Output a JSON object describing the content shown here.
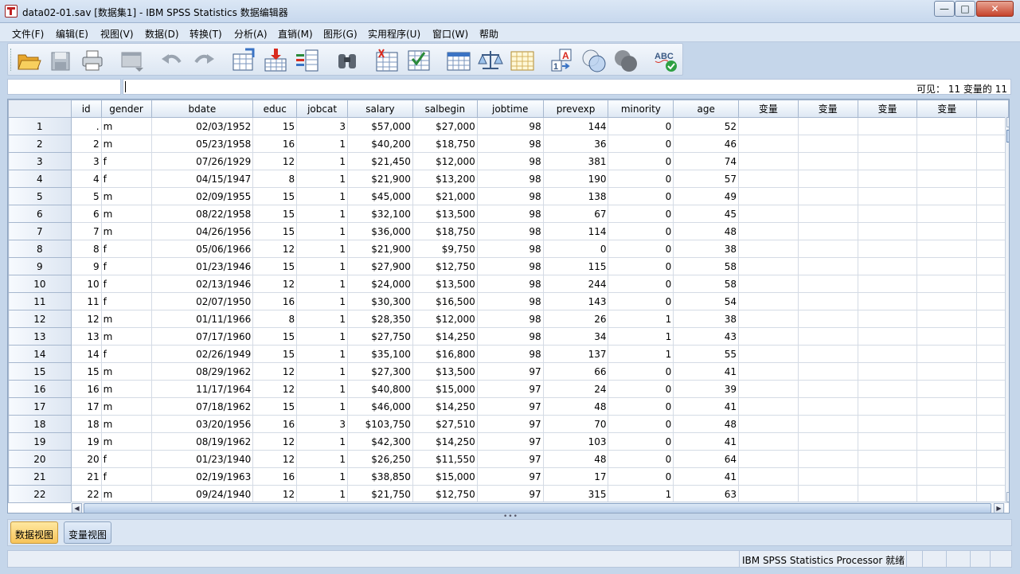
{
  "window": {
    "title": "data02-01.sav [数据集1] - IBM SPSS Statistics 数据编辑器",
    "minimize_label": "—",
    "maximize_label": "□",
    "close_label": "✕"
  },
  "menu": [
    "文件(F)",
    "编辑(E)",
    "视图(V)",
    "数据(D)",
    "转换(T)",
    "分析(A)",
    "直销(M)",
    "图形(G)",
    "实用程序(U)",
    "窗口(W)",
    "帮助"
  ],
  "toolbar_icons": [
    "open-folder-icon",
    "save-icon",
    "print-icon",
    "dialog-recall-icon",
    "undo-icon",
    "redo-icon",
    "goto-case-icon",
    "goto-variable-icon",
    "variables-icon",
    "find-icon",
    "insert-cases-icon",
    "insert-variable-icon",
    "split-file-icon",
    "weight-cases-icon",
    "select-cases-icon",
    "value-labels-icon",
    "use-variable-sets-icon",
    "show-all-variables-icon",
    "spell-check-icon"
  ],
  "cell_editor": {
    "reference": "",
    "value": "",
    "visible_count": "可见： 11 变量的 11"
  },
  "grid": {
    "columns": [
      "id",
      "gender",
      "bdate",
      "educ",
      "jobcat",
      "salary",
      "salbegin",
      "jobtime",
      "prevexp",
      "minority",
      "age",
      "变量",
      "变量",
      "变量",
      "变量"
    ],
    "rows": [
      [
        "1",
        ".",
        "m",
        "02/03/1952",
        "15",
        "3",
        "$57,000",
        "$27,000",
        "98",
        "144",
        "0",
        "52"
      ],
      [
        "2",
        "2",
        "m",
        "05/23/1958",
        "16",
        "1",
        "$40,200",
        "$18,750",
        "98",
        "36",
        "0",
        "46"
      ],
      [
        "3",
        "3",
        "f",
        "07/26/1929",
        "12",
        "1",
        "$21,450",
        "$12,000",
        "98",
        "381",
        "0",
        "74"
      ],
      [
        "4",
        "4",
        "f",
        "04/15/1947",
        "8",
        "1",
        "$21,900",
        "$13,200",
        "98",
        "190",
        "0",
        "57"
      ],
      [
        "5",
        "5",
        "m",
        "02/09/1955",
        "15",
        "1",
        "$45,000",
        "$21,000",
        "98",
        "138",
        "0",
        "49"
      ],
      [
        "6",
        "6",
        "m",
        "08/22/1958",
        "15",
        "1",
        "$32,100",
        "$13,500",
        "98",
        "67",
        "0",
        "45"
      ],
      [
        "7",
        "7",
        "m",
        "04/26/1956",
        "15",
        "1",
        "$36,000",
        "$18,750",
        "98",
        "114",
        "0",
        "48"
      ],
      [
        "8",
        "8",
        "f",
        "05/06/1966",
        "12",
        "1",
        "$21,900",
        "$9,750",
        "98",
        "0",
        "0",
        "38"
      ],
      [
        "9",
        "9",
        "f",
        "01/23/1946",
        "15",
        "1",
        "$27,900",
        "$12,750",
        "98",
        "115",
        "0",
        "58"
      ],
      [
        "10",
        "10",
        "f",
        "02/13/1946",
        "12",
        "1",
        "$24,000",
        "$13,500",
        "98",
        "244",
        "0",
        "58"
      ],
      [
        "11",
        "11",
        "f",
        "02/07/1950",
        "16",
        "1",
        "$30,300",
        "$16,500",
        "98",
        "143",
        "0",
        "54"
      ],
      [
        "12",
        "12",
        "m",
        "01/11/1966",
        "8",
        "1",
        "$28,350",
        "$12,000",
        "98",
        "26",
        "1",
        "38"
      ],
      [
        "13",
        "13",
        "m",
        "07/17/1960",
        "15",
        "1",
        "$27,750",
        "$14,250",
        "98",
        "34",
        "1",
        "43"
      ],
      [
        "14",
        "14",
        "f",
        "02/26/1949",
        "15",
        "1",
        "$35,100",
        "$16,800",
        "98",
        "137",
        "1",
        "55"
      ],
      [
        "15",
        "15",
        "m",
        "08/29/1962",
        "12",
        "1",
        "$27,300",
        "$13,500",
        "97",
        "66",
        "0",
        "41"
      ],
      [
        "16",
        "16",
        "m",
        "11/17/1964",
        "12",
        "1",
        "$40,800",
        "$15,000",
        "97",
        "24",
        "0",
        "39"
      ],
      [
        "17",
        "17",
        "m",
        "07/18/1962",
        "15",
        "1",
        "$46,000",
        "$14,250",
        "97",
        "48",
        "0",
        "41"
      ],
      [
        "18",
        "18",
        "m",
        "03/20/1956",
        "16",
        "3",
        "$103,750",
        "$27,510",
        "97",
        "70",
        "0",
        "48"
      ],
      [
        "19",
        "19",
        "m",
        "08/19/1962",
        "12",
        "1",
        "$42,300",
        "$14,250",
        "97",
        "103",
        "0",
        "41"
      ],
      [
        "20",
        "20",
        "f",
        "01/23/1940",
        "12",
        "1",
        "$26,250",
        "$11,550",
        "97",
        "48",
        "0",
        "64"
      ],
      [
        "21",
        "21",
        "f",
        "02/19/1963",
        "16",
        "1",
        "$38,850",
        "$15,000",
        "97",
        "17",
        "0",
        "41"
      ],
      [
        "22",
        "22",
        "m",
        "09/24/1940",
        "12",
        "1",
        "$21,750",
        "$12,750",
        "97",
        "315",
        "1",
        "63"
      ]
    ]
  },
  "tabs": {
    "data_view": "数据视图",
    "variable_view": "变量视图"
  },
  "status": {
    "processor": "IBM SPSS Statistics Processor 就绪"
  },
  "colors": {
    "accent_tab": "#f7c45a",
    "chrome": "#c5d6ea"
  }
}
